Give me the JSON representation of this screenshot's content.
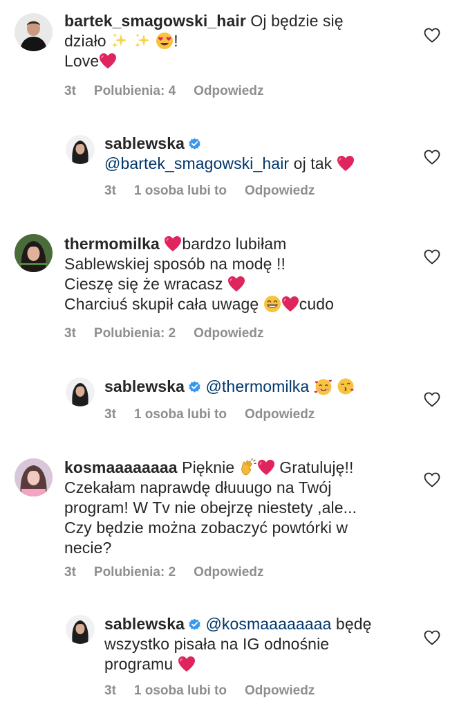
{
  "comments": [
    {
      "username": "bartek_smagowski_hair",
      "text_line1": "Oj będzie się",
      "text_line2": "działo",
      "text_line2_end": "!",
      "text_line3": "Love",
      "time": "3t",
      "likes": "Polubienia: 4",
      "reply": "Odpowiedz"
    },
    {
      "username": "sablewska",
      "mention": "@bartek_smagowski_hair",
      "text": "oj tak",
      "time": "3t",
      "likes": "1 osoba lubi to",
      "reply": "Odpowiedz"
    },
    {
      "username": "thermomilka",
      "text_line1": "bardzo lubiłam",
      "text_line2": "Sablewskiej sposób na modę !!",
      "text_line3": "Cieszę się że wracasz",
      "text_line4": "Charciuś skupił cała uwagę",
      "text_line4_end": "cudo",
      "time": "3t",
      "likes": "Polubienia: 2",
      "reply": "Odpowiedz"
    },
    {
      "username": "sablewska",
      "mention": "@thermomilka",
      "time": "3t",
      "likes": "1 osoba lubi to",
      "reply": "Odpowiedz"
    },
    {
      "username": "kosmaaaaaaaa",
      "text_line1a": "Pięknie",
      "text_line1b": "Gratuluję!!",
      "text_line2": "Czekałam naprawdę dłuuugo na Twój",
      "text_line3": "program! W Tv nie obejrzę niestety ,ale...",
      "text_line4": "Czy będzie można zobaczyć powtórki w",
      "text_line5": "necie?",
      "time": "3t",
      "likes": "Polubienia: 2",
      "reply": "Odpowiedz"
    },
    {
      "username": "sablewska",
      "mention": "@kosmaaaaaaaa",
      "text_line1": "będę",
      "text_line2": "wszystko pisała na IG odnośnie",
      "text_line3": "programu",
      "time": "3t",
      "likes": "1 osoba lubi to",
      "reply": "Odpowiedz"
    }
  ],
  "colors": {
    "text": "#262626",
    "meta": "#8e8e8e",
    "mention": "#00376b",
    "verified": "#3897f0",
    "heart": "#e0245e"
  },
  "icons": {
    "like": "heart-outline-icon",
    "verified": "verified-badge-icon",
    "heart_emoji": "red-heart-emoji",
    "sparkles": "sparkles-emoji",
    "heart_eyes": "heart-eyes-emoji",
    "grin": "grinning-emoji",
    "smiling_hearts": "smiling-face-with-hearts-emoji",
    "kiss": "face-blowing-kiss-emoji",
    "clap": "clapping-hands-emoji"
  }
}
